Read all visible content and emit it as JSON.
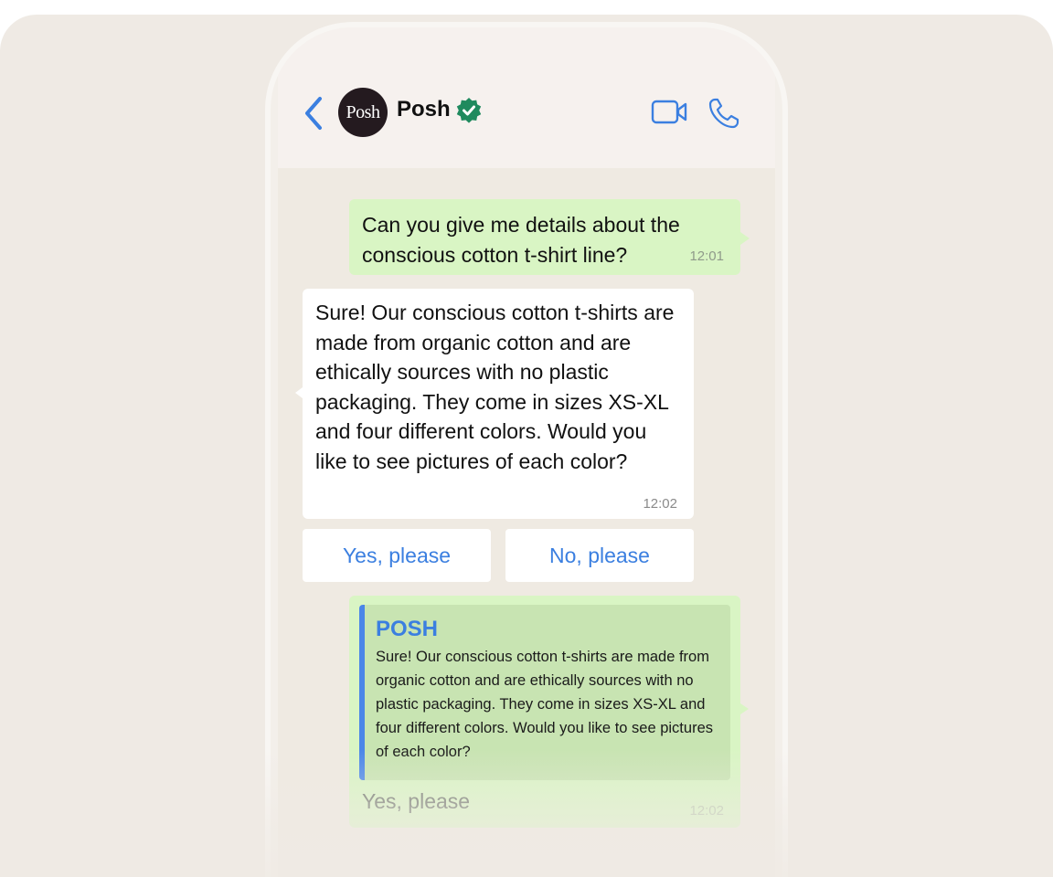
{
  "header": {
    "avatar_text": "Posh",
    "contact_name": "Posh"
  },
  "messages": [
    {
      "direction": "outgoing",
      "text": "Can you give me details about the conscious cotton t-shirt line?",
      "time": "12:01"
    },
    {
      "direction": "incoming",
      "text": "Sure! Our conscious cotton t-shirts are made from organic cotton and are ethically sources with no plastic packaging. They come in sizes XS-XL and four different colors. Would you like to see pictures of each color?",
      "time": "12:02"
    }
  ],
  "quick_replies": [
    "Yes, please",
    "No, please"
  ],
  "reply_message": {
    "quoted_author": "POSH",
    "quoted_text": "Sure! Our conscious cotton t-shirts are made from organic cotton and are ethically sources with no plastic packaging. They come in sizes XS-XL and four different colors. Would you like to see pictures of each color?",
    "text": "Yes, please",
    "time": "12:02"
  },
  "colors": {
    "accent": "#3b7fe0",
    "outgoing_bubble": "#d9f5c4",
    "incoming_bubble": "#ffffff",
    "verified_badge": "#1f8a5e",
    "avatar_bg": "#241a1f"
  }
}
